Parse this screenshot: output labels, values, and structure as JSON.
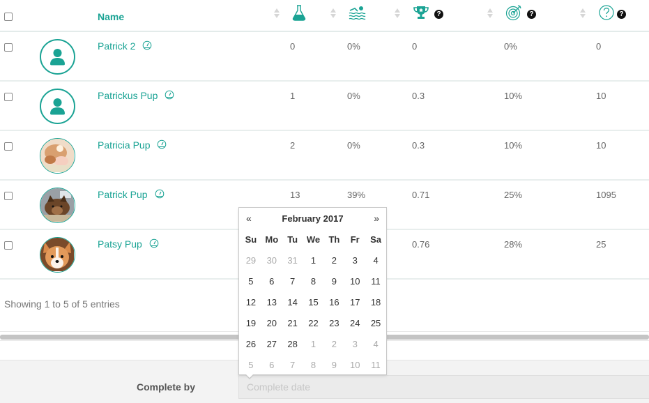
{
  "colors": {
    "accent": "#1aa394",
    "text": "#666666",
    "muted": "#aaaaaa"
  },
  "table": {
    "header": {
      "name_label": "Name",
      "columns": [
        {
          "icon": "flask-icon",
          "help": false
        },
        {
          "icon": "swimmer-icon",
          "help": false
        },
        {
          "icon": "trophy-icon",
          "help": true
        },
        {
          "icon": "target-icon",
          "help": true
        },
        {
          "icon": "question-circle-icon",
          "help": true
        }
      ],
      "help_glyph": "?"
    },
    "rows": [
      {
        "name": "Patrick 2",
        "avatar": "default",
        "values": [
          "0",
          "0%",
          "0",
          "0%",
          "0"
        ]
      },
      {
        "name": "Patrickus Pup",
        "avatar": "default",
        "values": [
          "1",
          "0%",
          "0.3",
          "10%",
          "10"
        ]
      },
      {
        "name": "Patricia Pup",
        "avatar": "photo-puppy-sleeping",
        "values": [
          "2",
          "0%",
          "0.3",
          "10%",
          "10"
        ]
      },
      {
        "name": "Patrick Pup",
        "avatar": "photo-dog-lying",
        "values": [
          "13",
          "39%",
          "0.71",
          "25%",
          "1095"
        ]
      },
      {
        "name": "Patsy Pup",
        "avatar": "photo-corgi-puppy",
        "values": [
          "",
          "",
          "0.76",
          "28%",
          "25"
        ]
      }
    ],
    "info": "Showing 1 to 5 of 5 entries"
  },
  "form": {
    "complete_by_label": "Complete by",
    "complete_date_placeholder": "Complete date",
    "complete_date_value": ""
  },
  "datepicker": {
    "prev": "«",
    "next": "»",
    "title": "February 2017",
    "weekdays": [
      "Su",
      "Mo",
      "Tu",
      "We",
      "Th",
      "Fr",
      "Sa"
    ],
    "weeks": [
      [
        {
          "d": "29",
          "o": true
        },
        {
          "d": "30",
          "o": true
        },
        {
          "d": "31",
          "o": true
        },
        {
          "d": "1"
        },
        {
          "d": "2"
        },
        {
          "d": "3"
        },
        {
          "d": "4"
        }
      ],
      [
        {
          "d": "5"
        },
        {
          "d": "6"
        },
        {
          "d": "7"
        },
        {
          "d": "8"
        },
        {
          "d": "9"
        },
        {
          "d": "10"
        },
        {
          "d": "11"
        }
      ],
      [
        {
          "d": "12"
        },
        {
          "d": "13"
        },
        {
          "d": "14"
        },
        {
          "d": "15"
        },
        {
          "d": "16"
        },
        {
          "d": "17"
        },
        {
          "d": "18"
        }
      ],
      [
        {
          "d": "19"
        },
        {
          "d": "20"
        },
        {
          "d": "21"
        },
        {
          "d": "22"
        },
        {
          "d": "23"
        },
        {
          "d": "24"
        },
        {
          "d": "25"
        }
      ],
      [
        {
          "d": "26"
        },
        {
          "d": "27"
        },
        {
          "d": "28"
        },
        {
          "d": "1",
          "o": true
        },
        {
          "d": "2",
          "o": true
        },
        {
          "d": "3",
          "o": true
        },
        {
          "d": "4",
          "o": true
        }
      ],
      [
        {
          "d": "5",
          "o": true
        },
        {
          "d": "6",
          "o": true
        },
        {
          "d": "7",
          "o": true
        },
        {
          "d": "8",
          "o": true
        },
        {
          "d": "9",
          "o": true
        },
        {
          "d": "10",
          "o": true
        },
        {
          "d": "11",
          "o": true
        }
      ]
    ]
  }
}
